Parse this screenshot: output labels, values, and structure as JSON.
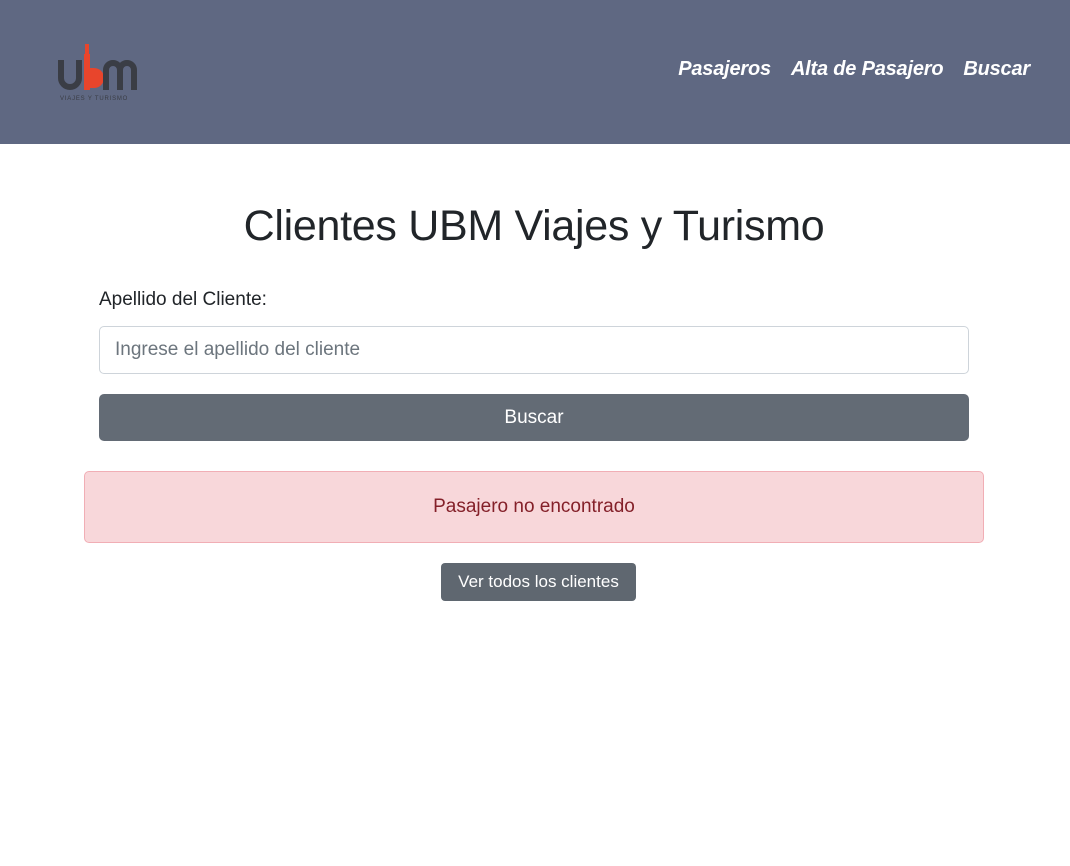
{
  "navbar": {
    "logo": {
      "text": "ubm",
      "tagline": "VIAJES Y TURISMO",
      "colors": {
        "letters": "#3a3d45",
        "accent": "#e8452c"
      }
    },
    "links": [
      {
        "label": "Pasajeros"
      },
      {
        "label": "Alta de Pasajero"
      },
      {
        "label": "Buscar"
      }
    ],
    "background": "#5f6882"
  },
  "main": {
    "title": "Clientes UBM Viajes y Turismo",
    "search": {
      "label": "Apellido del Cliente:",
      "placeholder": "Ingrese el apellido del cliente",
      "value": "",
      "button_label": "Buscar"
    },
    "alert": {
      "message": "Pasajero no encontrado",
      "type": "danger"
    },
    "view_all_label": "Ver todos los clientes"
  }
}
